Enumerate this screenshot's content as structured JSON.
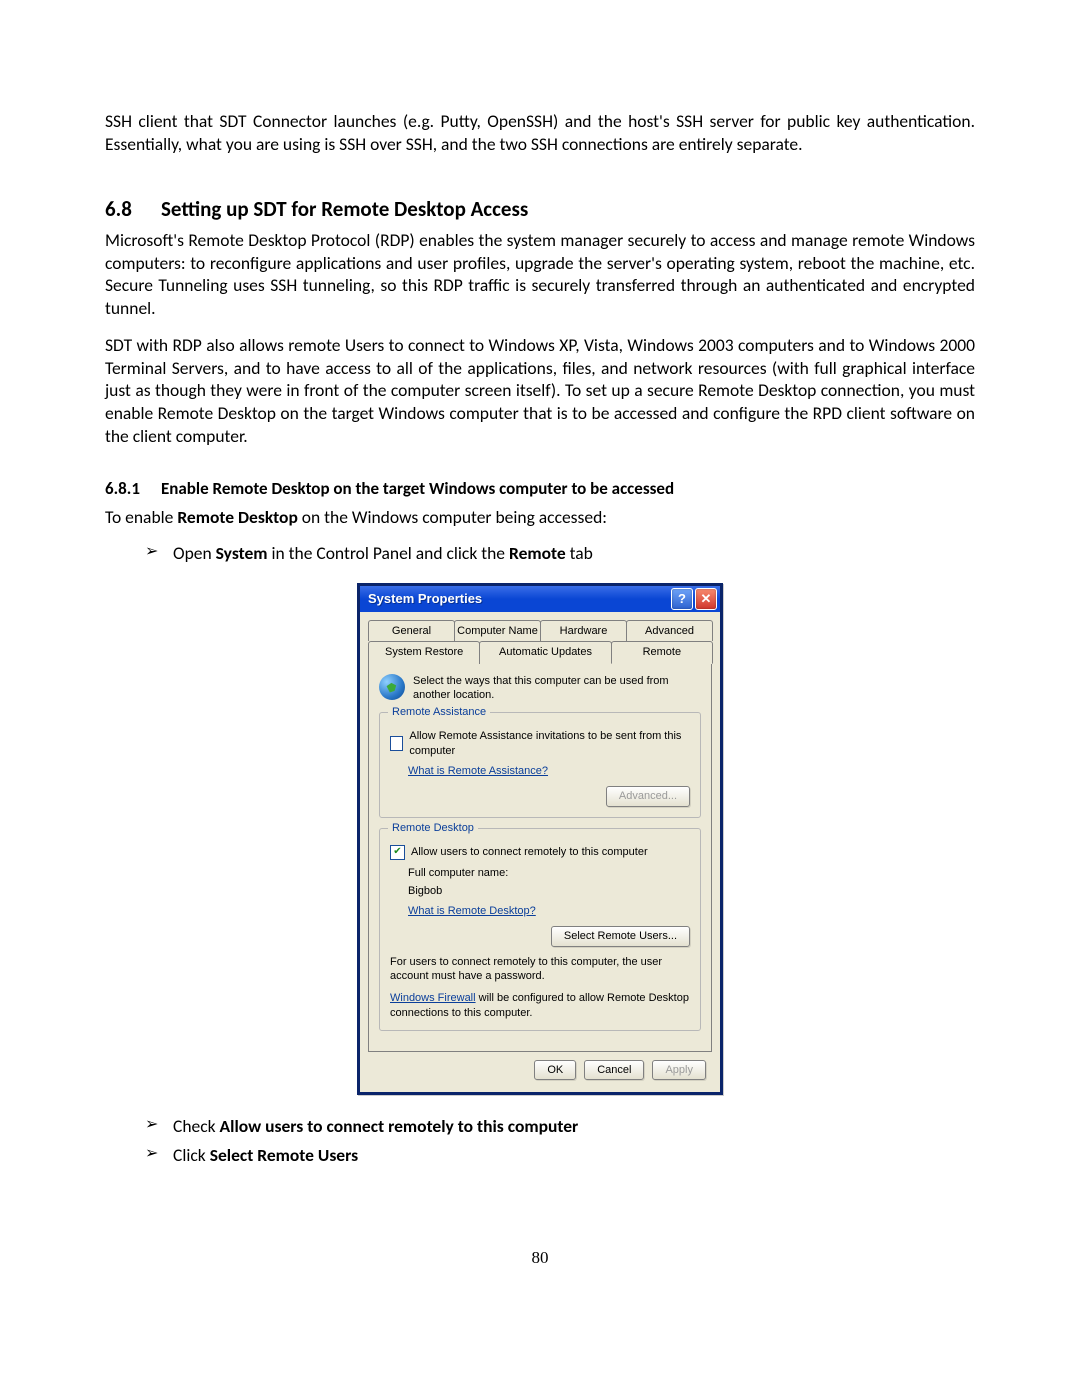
{
  "intro_para": "SSH client that SDT Connector launches (e.g. Putty, OpenSSH) and the host's SSH server for public key authentication. Essentially, what you are using is SSH over SSH, and the two SSH connections are entirely separate.",
  "section": {
    "num": "6.8",
    "title": "Setting up SDT for Remote Desktop Access",
    "p1": "Microsoft's Remote Desktop Protocol (RDP) enables the system manager securely to access and manage remote Windows computers: to reconfigure applications and user profiles, upgrade the server's operating system, reboot the machine, etc. Secure Tunneling uses SSH tunneling, so this RDP traffic is securely transferred through an authenticated and encrypted tunnel.",
    "p2": "SDT with RDP also allows remote Users to connect to Windows XP, Vista, Windows 2003 computers and to Windows 2000 Terminal Servers, and to have access to all of the applications, files, and network resources (with full graphical interface just as though they were in front of the computer screen itself). To set up a secure Remote Desktop connection, you must enable Remote Desktop on the target Windows computer that is to be accessed and configure the RPD client software on the client computer."
  },
  "subsection": {
    "num": "6.8.1",
    "title": "Enable Remote Desktop on the target Windows computer to be accessed",
    "lead_pre": "To enable ",
    "lead_bold": "Remote Desktop",
    "lead_post": " on the Windows computer being accessed:",
    "step1_pre": "Open ",
    "step1_b1": "System",
    "step1_mid": " in the Control Panel and click the ",
    "step1_b2": "Remote",
    "step1_post": " tab",
    "step2_pre": "Check ",
    "step2_b": "Allow users to connect remotely to this computer",
    "step3_pre": "Click ",
    "step3_b": "Select Remote Users"
  },
  "dialog": {
    "title": "System Properties",
    "help_symbol": "?",
    "close_symbol": "✕",
    "tabs_row1": [
      "General",
      "Computer Name",
      "Hardware",
      "Advanced"
    ],
    "tabs_row2": [
      "System Restore",
      "Automatic Updates",
      "Remote"
    ],
    "intro": "Select the ways that this computer can be used from another location.",
    "group_ra": {
      "legend": "Remote Assistance",
      "chk_label": "Allow Remote Assistance invitations to be sent from this computer",
      "link": "What is Remote Assistance?",
      "advanced_btn": "Advanced..."
    },
    "group_rd": {
      "legend": "Remote Desktop",
      "chk_label": "Allow users to connect remotely to this computer",
      "full_name_label": "Full computer name:",
      "computer_name": "Bigbob",
      "link": "What is Remote Desktop?",
      "select_users_btn": "Select Remote Users...",
      "note1": "For users to connect remotely to this computer, the user account must have a password.",
      "note2_link": "Windows Firewall",
      "note2_rest": " will be configured to allow Remote Desktop connections to this computer."
    },
    "buttons": {
      "ok": "OK",
      "cancel": "Cancel",
      "apply": "Apply"
    }
  },
  "page_number": "80"
}
